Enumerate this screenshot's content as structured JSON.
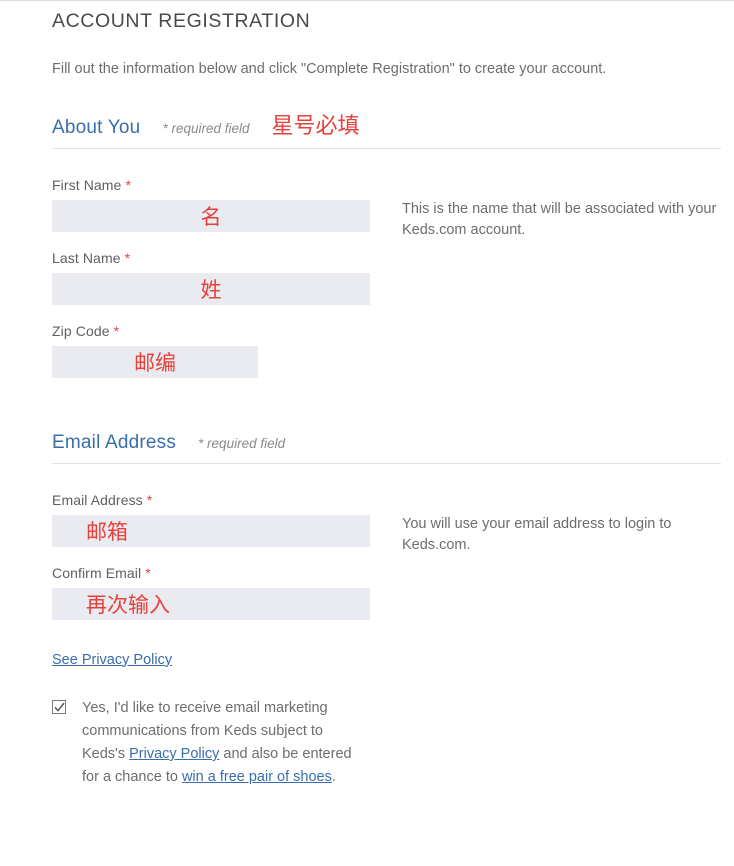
{
  "page": {
    "title": "ACCOUNT REGISTRATION",
    "intro": "Fill out the information below and click \"Complete Registration\" to create your account."
  },
  "about_section": {
    "title": "About You",
    "required_note": "* required field",
    "annotation": "星号必填",
    "helper_text": "This is the name that will be associated with your Keds.com account.",
    "fields": [
      {
        "label": "First Name",
        "required_mark": "*",
        "value": "名",
        "align": "center",
        "width": "full"
      },
      {
        "label": "Last Name",
        "required_mark": "*",
        "value": "姓",
        "align": "center",
        "width": "full"
      },
      {
        "label": "Zip Code",
        "required_mark": "*",
        "value": "邮编",
        "align": "center",
        "width": "zip"
      }
    ]
  },
  "email_section": {
    "title": "Email Address",
    "required_note": "* required field",
    "helper_text": "You will use your email address to login to Keds.com.",
    "fields": [
      {
        "label": "Email Address",
        "required_mark": "*",
        "value": "邮箱",
        "align": "left",
        "width": "full"
      },
      {
        "label": "Confirm Email",
        "required_mark": "*",
        "value": "再次输入",
        "align": "left",
        "width": "full"
      }
    ],
    "privacy_link": "See Privacy Policy",
    "consent": {
      "checked": true,
      "part1": "Yes, I'd like to receive email marketing communications from Keds subject to Keds's ",
      "link1": "Privacy Policy",
      "part2": " and also be entered for a chance to ",
      "link2": "win a free pair of shoes",
      "part3": "."
    }
  },
  "colors": {
    "heading_blue": "#3a6ea8",
    "annotation_red": "#e8413c",
    "input_bg": "#e9ebf0",
    "body_text": "#6d6d6d"
  }
}
